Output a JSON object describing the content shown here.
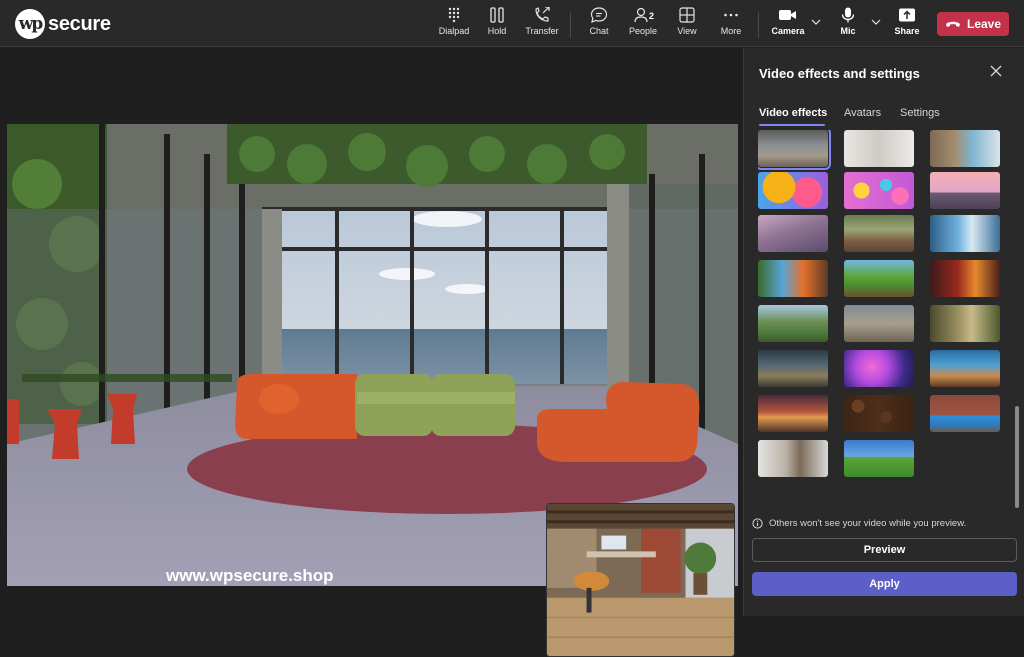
{
  "brand": {
    "logo_mark": "wp",
    "logo_text": "secure"
  },
  "toolbar": {
    "dialpad": "Dialpad",
    "hold": "Hold",
    "transfer": "Transfer",
    "chat": "Chat",
    "people": "People",
    "people_count": "2",
    "view": "View",
    "more": "More",
    "camera": "Camera",
    "mic": "Mic",
    "share": "Share",
    "leave": "Leave"
  },
  "stage": {
    "watermark": "www.wpsecure.shop"
  },
  "panel": {
    "title": "Video effects and settings",
    "tabs": [
      "Video effects",
      "Avatars",
      "Settings"
    ],
    "active_tab": "Video effects",
    "thumbnails": [
      {
        "name": "bg-room-glass",
        "selected": true
      },
      {
        "name": "bg-white-room"
      },
      {
        "name": "bg-sea-office"
      },
      {
        "name": "bg-balloons"
      },
      {
        "name": "bg-pink-spheres"
      },
      {
        "name": "bg-bridge-sunset"
      },
      {
        "name": "bg-pink-mountains"
      },
      {
        "name": "bg-classroom"
      },
      {
        "name": "bg-blue-lab"
      },
      {
        "name": "bg-minecraft-waterfall"
      },
      {
        "name": "bg-minecraft-village"
      },
      {
        "name": "bg-minecraft-nether"
      },
      {
        "name": "bg-green-valley"
      },
      {
        "name": "bg-stone-arch"
      },
      {
        "name": "bg-ruins-forest"
      },
      {
        "name": "bg-sci-fi-landscape"
      },
      {
        "name": "bg-purple-nebula"
      },
      {
        "name": "bg-alien-world"
      },
      {
        "name": "bg-fantasy-town"
      },
      {
        "name": "bg-coffee-beans"
      },
      {
        "name": "bg-brick-sofa"
      },
      {
        "name": "bg-kitchen"
      },
      {
        "name": "bg-green-hill"
      }
    ],
    "info": "Others won't see your video while you preview.",
    "preview_button": "Preview",
    "apply_button": "Apply"
  },
  "colors": {
    "leave": "#c4314b",
    "apply": "#5b5fc7",
    "accent": "#7f85f5",
    "panel_bg": "#292929",
    "stage_bg": "#1f1f1f"
  }
}
